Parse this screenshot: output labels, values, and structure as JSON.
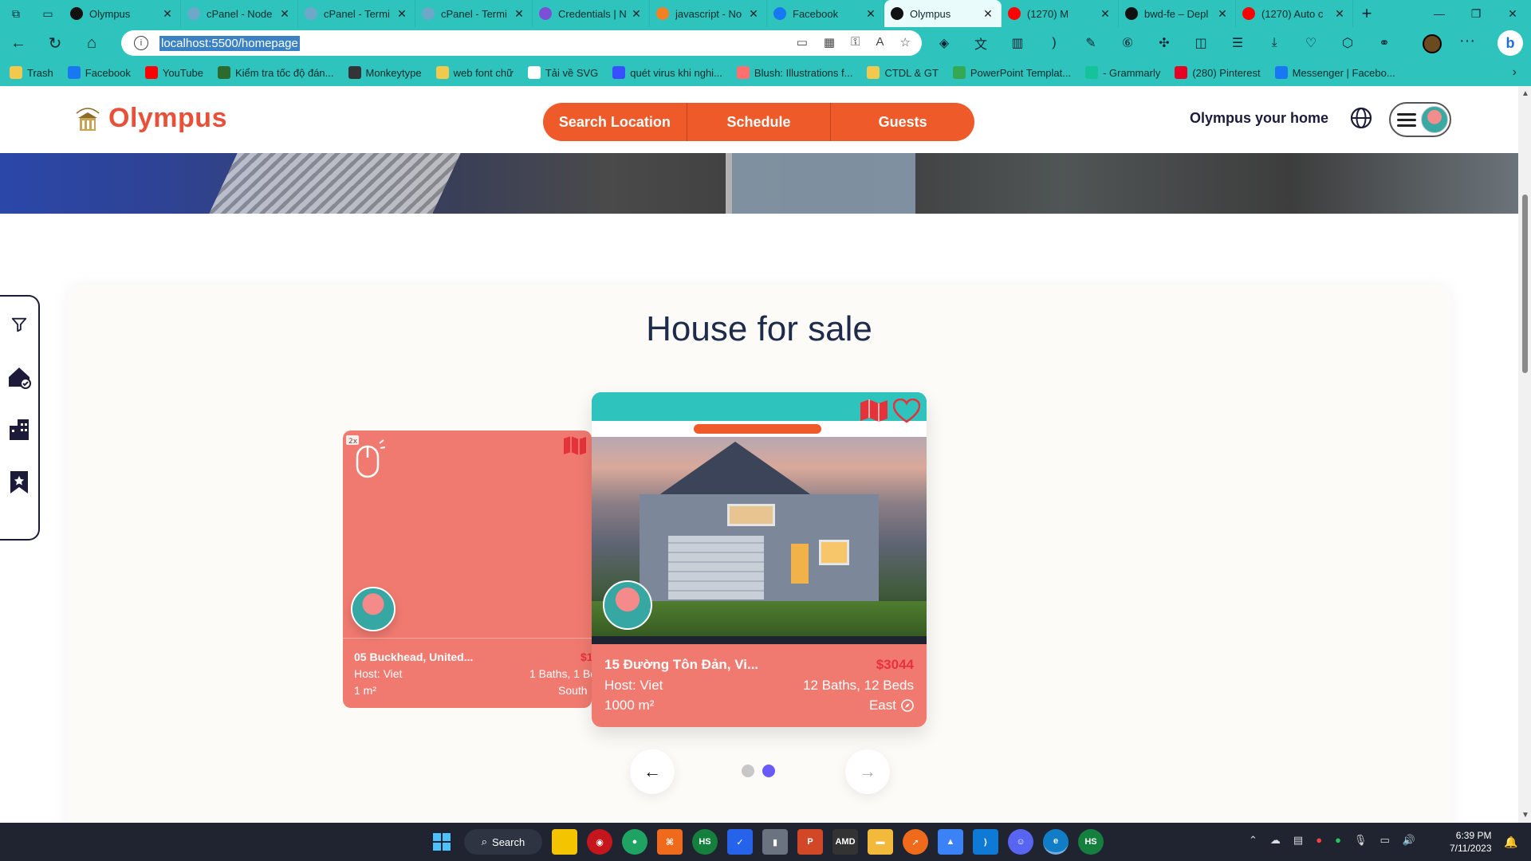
{
  "browser": {
    "tabs": [
      {
        "title": "Olympus",
        "icon": "olympus-icon",
        "color": "#111111"
      },
      {
        "title": "cPanel - Node",
        "icon": "cpanel-icon",
        "color": "#6ea8c8"
      },
      {
        "title": "cPanel - Termi",
        "icon": "cpanel-icon",
        "color": "#6ea8c8"
      },
      {
        "title": "cPanel - Termi",
        "icon": "cpanel-icon",
        "color": "#6ea8c8"
      },
      {
        "title": "Credentials | N",
        "icon": "credentials-icon",
        "color": "#7b4fd6"
      },
      {
        "title": "javascript - No",
        "icon": "stackoverflow-icon",
        "color": "#f48024"
      },
      {
        "title": "Facebook",
        "icon": "facebook-icon",
        "color": "#1877f2"
      },
      {
        "title": "Olympus",
        "icon": "olympus-icon",
        "color": "#111111"
      },
      {
        "title": "(1270) M",
        "icon": "youtube-icon",
        "color": "#ff0000"
      },
      {
        "title": "bwd-fe – Depl",
        "icon": "vercel-icon",
        "color": "#111111"
      },
      {
        "title": "(1270) Auto c",
        "icon": "youtube-icon",
        "color": "#ff0000"
      }
    ],
    "active_tab_index": 7,
    "url": "localhost:5500/homepage",
    "bookmarks": [
      {
        "label": "Trash",
        "icon": "folder-icon",
        "color": "#f2c94c"
      },
      {
        "label": "Facebook",
        "icon": "facebook-icon",
        "color": "#1877f2"
      },
      {
        "label": "YouTube",
        "icon": "youtube-icon",
        "color": "#ff0000"
      },
      {
        "label": "Kiểm tra tốc độ đán...",
        "icon": "speed-icon",
        "color": "#2d6a2d"
      },
      {
        "label": "Monkeytype",
        "icon": "monkeytype-icon",
        "color": "#323437"
      },
      {
        "label": "web font chữ",
        "icon": "folder-icon",
        "color": "#f2c94c"
      },
      {
        "label": "Tải về SVG",
        "icon": "document-icon",
        "color": "#ffffff"
      },
      {
        "label": "quét virus khi nghi...",
        "icon": "virustotal-icon",
        "color": "#394eff"
      },
      {
        "label": "Blush: Illustrations f...",
        "icon": "blush-icon",
        "color": "#ff6f6f"
      },
      {
        "label": "CTDL & GT",
        "icon": "folder-icon",
        "color": "#f2c94c"
      },
      {
        "label": "PowerPoint Templat...",
        "icon": "drive-icon",
        "color": "#34a853"
      },
      {
        "label": "- Grammarly",
        "icon": "grammarly-icon",
        "color": "#15c39a"
      },
      {
        "label": "(280) Pinterest",
        "icon": "pinterest-icon",
        "color": "#e60023"
      },
      {
        "label": "Messenger | Facebo...",
        "icon": "facebook-icon",
        "color": "#1877f2"
      }
    ]
  },
  "site": {
    "brand": "Olympus",
    "logo_small_text": "OLYMPUS",
    "nav": [
      "Search Location",
      "Schedule",
      "Guests"
    ],
    "tagline": "Olympus your home",
    "accent": "#ef5a2a",
    "brand_color": "#e8503a"
  },
  "section": {
    "title": "House for sale",
    "cards": [
      {
        "location": "05 Buckhead, United...",
        "price": "$1",
        "host": "Host: Viet",
        "beds": "1 Baths, 1 Be",
        "area": "1 m²",
        "direction": "South"
      },
      {
        "location": "15 Đường Tôn Đản, Vi...",
        "price": "$3044",
        "host": "Host: Viet",
        "beds": "12 Baths, 12 Beds",
        "area": "1000 m²",
        "direction": "East"
      }
    ],
    "carousel": {
      "pages": 2,
      "active_page": 2
    }
  },
  "taskbar": {
    "search_label": "Search",
    "time": "6:39 PM",
    "date": "7/11/2023"
  }
}
